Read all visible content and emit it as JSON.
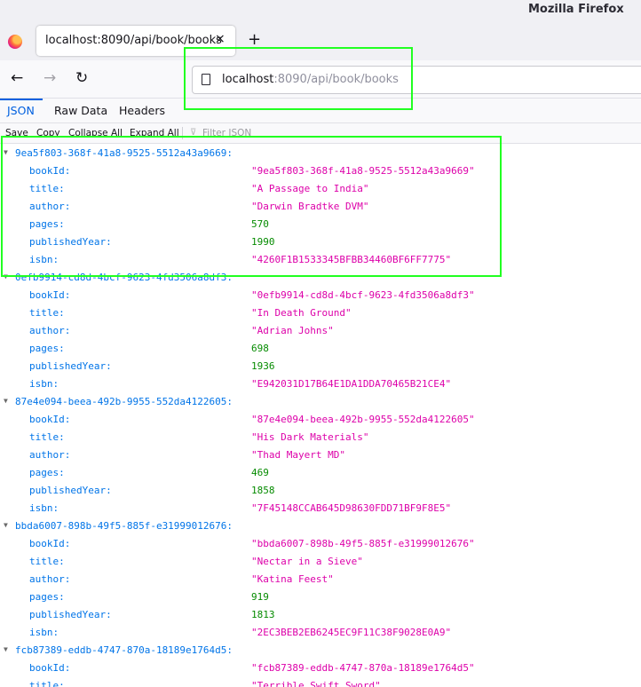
{
  "window": {
    "title": "Mozilla Firefox"
  },
  "tab": {
    "title": "localhost:8090/api/book/books",
    "close": "×",
    "new_tab": "+"
  },
  "nav": {
    "back": "←",
    "forward": "→",
    "reload": "↻"
  },
  "url": {
    "host": "localhost",
    "rest": ":8090/api/book/books"
  },
  "viewer_tabs": {
    "json": "JSON",
    "raw": "Raw Data",
    "headers": "Headers"
  },
  "toolbar": {
    "save": "Save",
    "copy": "Copy",
    "collapse": "Collapse All",
    "expand": "Expand All",
    "filter_icon": "⊽",
    "filter_placeholder": "Filter JSON"
  },
  "books": [
    {
      "id": "9ea5f803-368f-41a8-9525-5512a43a9669:",
      "fields": [
        {
          "key": "bookId:",
          "value": "\"9ea5f803-368f-41a8-9525-5512a43a9669\"",
          "type": "str"
        },
        {
          "key": "title:",
          "value": "\"A Passage to India\"",
          "type": "str"
        },
        {
          "key": "author:",
          "value": "\"Darwin Bradtke DVM\"",
          "type": "str"
        },
        {
          "key": "pages:",
          "value": "570",
          "type": "num"
        },
        {
          "key": "publishedYear:",
          "value": "1990",
          "type": "num"
        },
        {
          "key": "isbn:",
          "value": "\"4260F1B1533345BFBB34460BF6FF7775\"",
          "type": "str"
        }
      ]
    },
    {
      "id": "0efb9914-cd8d-4bcf-9623-4fd3506a8df3:",
      "fields": [
        {
          "key": "bookId:",
          "value": "\"0efb9914-cd8d-4bcf-9623-4fd3506a8df3\"",
          "type": "str"
        },
        {
          "key": "title:",
          "value": "\"In Death Ground\"",
          "type": "str"
        },
        {
          "key": "author:",
          "value": "\"Adrian Johns\"",
          "type": "str"
        },
        {
          "key": "pages:",
          "value": "698",
          "type": "num"
        },
        {
          "key": "publishedYear:",
          "value": "1936",
          "type": "num"
        },
        {
          "key": "isbn:",
          "value": "\"E942031D17B64E1DA1DDA70465B21CE4\"",
          "type": "str"
        }
      ]
    },
    {
      "id": "87e4e094-beea-492b-9955-552da4122605:",
      "fields": [
        {
          "key": "bookId:",
          "value": "\"87e4e094-beea-492b-9955-552da4122605\"",
          "type": "str"
        },
        {
          "key": "title:",
          "value": "\"His Dark Materials\"",
          "type": "str"
        },
        {
          "key": "author:",
          "value": "\"Thad Mayert MD\"",
          "type": "str"
        },
        {
          "key": "pages:",
          "value": "469",
          "type": "num"
        },
        {
          "key": "publishedYear:",
          "value": "1858",
          "type": "num"
        },
        {
          "key": "isbn:",
          "value": "\"7F45148CCAB645D98630FDD71BF9F8E5\"",
          "type": "str"
        }
      ]
    },
    {
      "id": "bbda6007-898b-49f5-885f-e31999012676:",
      "fields": [
        {
          "key": "bookId:",
          "value": "\"bbda6007-898b-49f5-885f-e31999012676\"",
          "type": "str"
        },
        {
          "key": "title:",
          "value": "\"Nectar in a Sieve\"",
          "type": "str"
        },
        {
          "key": "author:",
          "value": "\"Katina Feest\"",
          "type": "str"
        },
        {
          "key": "pages:",
          "value": "919",
          "type": "num"
        },
        {
          "key": "publishedYear:",
          "value": "1813",
          "type": "num"
        },
        {
          "key": "isbn:",
          "value": "\"2EC3BEB2EB6245EC9F11C38F9028E0A9\"",
          "type": "str"
        }
      ]
    },
    {
      "id": "fcb87389-eddb-4747-870a-18189e1764d5:",
      "fields": [
        {
          "key": "bookId:",
          "value": "\"fcb87389-eddb-4747-870a-18189e1764d5\"",
          "type": "str"
        },
        {
          "key": "title:",
          "value": "\"Terrible Swift Sword\"",
          "type": "str"
        }
      ]
    }
  ]
}
